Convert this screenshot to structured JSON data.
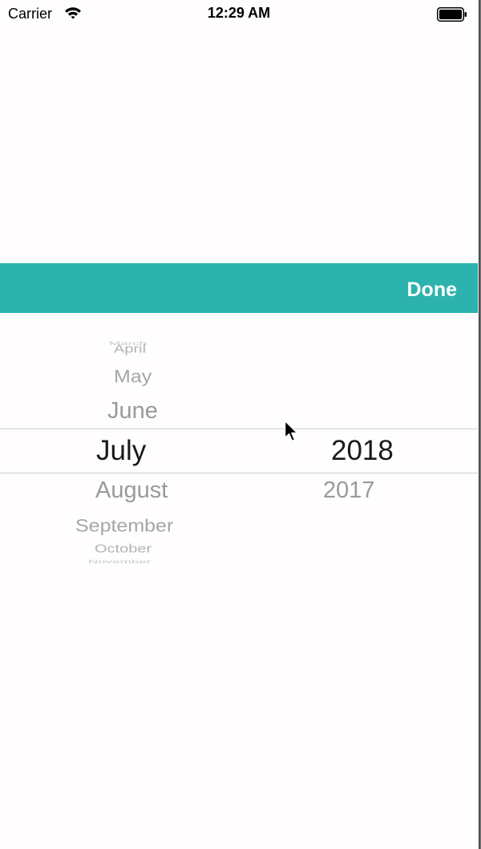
{
  "status_bar": {
    "carrier": "Carrier",
    "time": "12:29 AM",
    "icons": [
      "wifi-icon",
      "battery-icon"
    ]
  },
  "toolbar": {
    "done_label": "Done",
    "background_color": "#2db3ae"
  },
  "picker": {
    "months": [
      "March",
      "April",
      "May",
      "June",
      "July",
      "August",
      "September",
      "October",
      "November"
    ],
    "selected_month": "July",
    "years": [
      "2018",
      "2017"
    ],
    "selected_year": "2018"
  }
}
